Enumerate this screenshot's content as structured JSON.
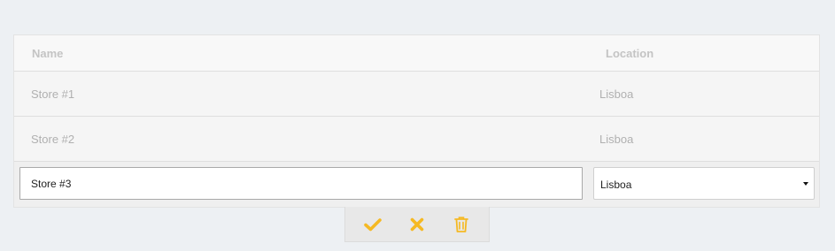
{
  "table": {
    "columns": {
      "name": "Name",
      "location": "Location"
    },
    "rows": [
      {
        "name": "Store #1",
        "location": "Lisboa"
      },
      {
        "name": "Store #2",
        "location": "Lisboa"
      }
    ],
    "edit_row": {
      "name_value": "Store #3",
      "location_value": "Lisboa"
    }
  },
  "actions": {
    "icons": [
      "check-icon",
      "close-icon",
      "trash-icon"
    ]
  },
  "colors": {
    "action_icon": "#f5b923",
    "background": "#edf0f3"
  }
}
